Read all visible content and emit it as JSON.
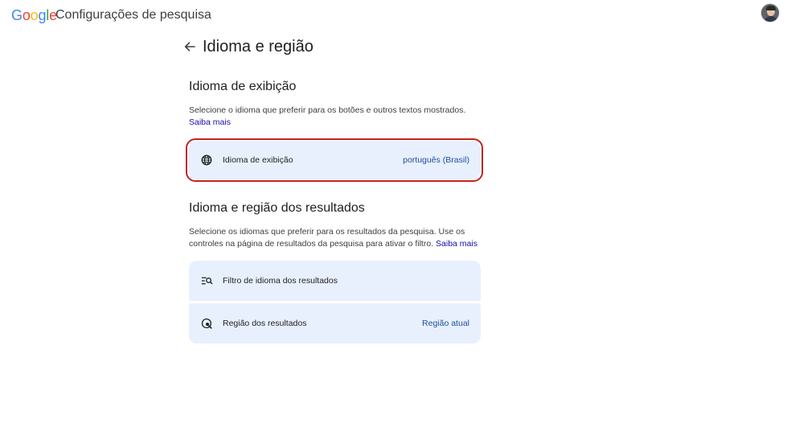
{
  "header": {
    "logo_letters": [
      "G",
      "o",
      "o",
      "g",
      "l",
      "e"
    ],
    "app_title": "Configurações de pesquisa"
  },
  "page": {
    "title": "Idioma e região"
  },
  "display_language": {
    "heading": "Idioma de exibição",
    "description": "Selecione o idioma que preferir para os botões e outros textos mostrados.",
    "learn_more": "Saiba mais",
    "row": {
      "label": "Idioma de exibição",
      "value": "português (Brasil)",
      "icon": "globe-icon"
    }
  },
  "results_language": {
    "heading": "Idioma e região dos resultados",
    "description": "Selecione os idiomas que preferir para os resultados da pesquisa. Use os controles na página de resultados da pesquisa para ativar o filtro.",
    "learn_more": "Saiba mais",
    "rows": [
      {
        "label": "Filtro de idioma dos resultados",
        "value": "",
        "icon": "filter-search-icon"
      },
      {
        "label": "Região dos resultados",
        "value": "Região atual",
        "icon": "region-search-icon"
      }
    ]
  },
  "colors": {
    "accent_highlight": "#c5221f",
    "card_bg": "#e8f0fe",
    "link": "#1a0dab"
  }
}
